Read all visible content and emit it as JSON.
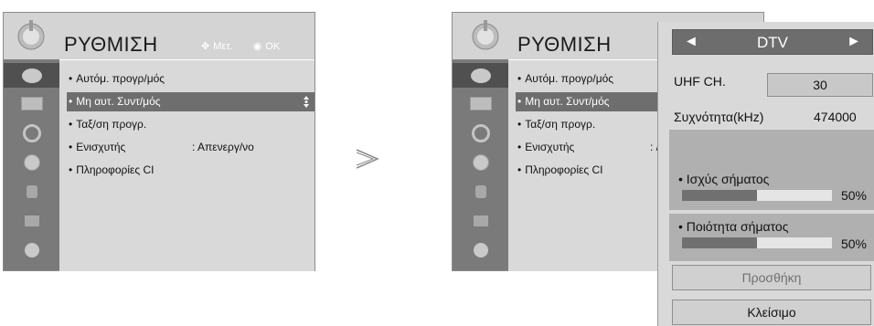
{
  "menu": {
    "title": "ΡΥΘΜΙΣΗ",
    "hint_move": "Μετ.",
    "hint_ok": "OK",
    "items": [
      {
        "label": "Αυτόμ. προγρ/μός",
        "value": ""
      },
      {
        "label": "Μη αυτ. Συντ/μός",
        "value": ""
      },
      {
        "label": "Ταξ/ση προγρ.",
        "value": ""
      },
      {
        "label": "Ενισχυτής",
        "value": ": Απενεργ/νο"
      },
      {
        "label": "Πληροφορίες CI",
        "value": ""
      }
    ],
    "selected_item": "Μη αυτ. Συντ/μός",
    "right_items_value_truncated": ": /"
  },
  "sidebar_icons": [
    "satellite-dish-icon",
    "screen-icon",
    "audio-icon",
    "clock-icon",
    "lock-icon",
    "option-icon",
    "network-icon"
  ],
  "popup": {
    "mode": "DTV",
    "left_arrow": "◄",
    "right_arrow": "►",
    "uhf_label": "UHF CH.",
    "uhf_value": "30",
    "freq_label": "Συχνότητα(kHz)",
    "freq_value": "474000",
    "strength_label": "• Ισχύς σήματος",
    "strength_pct": "50%",
    "strength_value": 0.5,
    "quality_label": "• Ποιότητα σήματος",
    "quality_pct": "50%",
    "quality_value": 0.5,
    "add_label": "Προσθήκη",
    "close_label": "Κλείσιμο"
  },
  "chevron": ">",
  "colors": {
    "panel": "#d4d4d4",
    "sidebar": "#7a7a7a",
    "highlight": "#6e6e6e",
    "popup_header": "#6d6d6d"
  }
}
